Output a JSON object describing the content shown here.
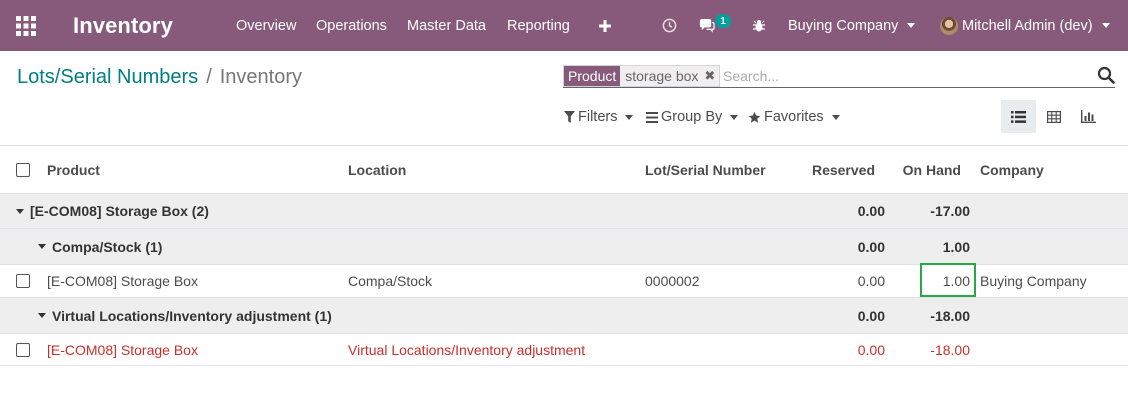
{
  "navbar": {
    "app_name": "Inventory",
    "menu": [
      {
        "label": "Overview"
      },
      {
        "label": "Operations"
      },
      {
        "label": "Master Data"
      },
      {
        "label": "Reporting"
      }
    ],
    "add_icon": "plus-icon",
    "activity_icon": "clock-icon",
    "messages_icon": "chat-icon",
    "messages_count": "1",
    "debug_icon": "bug-icon",
    "company": "Buying Company",
    "user": "Mitchell Admin (dev)",
    "bg_color": "#875a7b"
  },
  "breadcrumb": {
    "parent": "Lots/Serial Numbers",
    "separator": "/",
    "current": "Inventory"
  },
  "search": {
    "facet_label": "Product",
    "facet_value": "storage box",
    "placeholder": "Search..."
  },
  "filters": {
    "filters_label": "Filters",
    "group_by_label": "Group By",
    "favorites_label": "Favorites"
  },
  "views": [
    "list-view-icon",
    "pivot-view-icon",
    "graph-view-icon"
  ],
  "table": {
    "columns": {
      "product": "Product",
      "location": "Location",
      "lot": "Lot/Serial Number",
      "reserved": "Reserved",
      "on_hand": "On Hand",
      "company": "Company"
    },
    "group_root": {
      "label": "[E-COM08] Storage Box (2)",
      "reserved": "0.00",
      "on_hand": "-17.00"
    },
    "group_stock": {
      "label": "Compa/Stock (1)",
      "reserved": "0.00",
      "on_hand": "1.00"
    },
    "row1": {
      "product": "[E-COM08] Storage Box",
      "location": "Compa/Stock",
      "lot": "0000002",
      "reserved": "0.00",
      "on_hand": "1.00",
      "company": "Buying Company"
    },
    "group_virtual": {
      "label": "Virtual Locations/Inventory adjustment (1)",
      "reserved": "0.00",
      "on_hand": "-18.00"
    },
    "row2": {
      "product": "[E-COM08] Storage Box",
      "location": "Virtual Locations/Inventory adjustment",
      "lot": "",
      "reserved": "0.00",
      "on_hand": "-18.00",
      "company": ""
    }
  },
  "colors": {
    "accent": "#875a7b",
    "link": "#017e84",
    "badge": "#00a09d",
    "negative": "#c9302c",
    "edit_border": "#28a745"
  }
}
